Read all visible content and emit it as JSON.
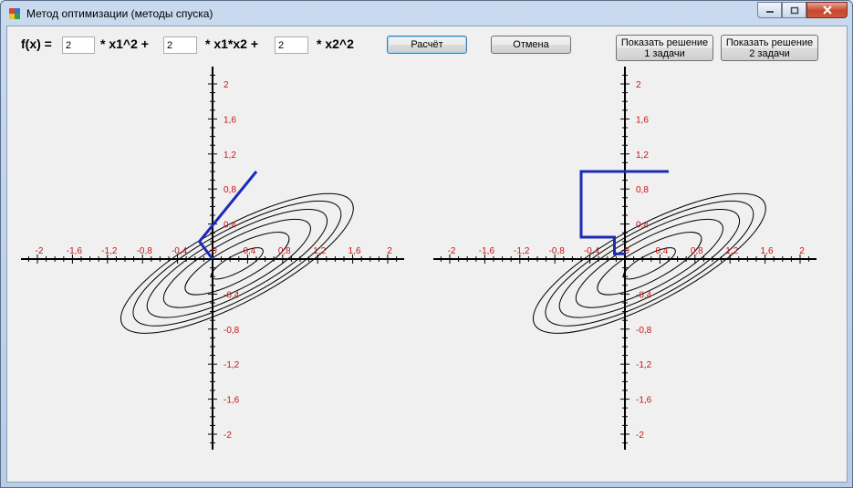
{
  "window": {
    "title": "Метод оптимизации (методы спуска)"
  },
  "form": {
    "fx_label": "f(x)  =",
    "coef1": "2",
    "term1_label": "* x1^2 +",
    "coef2": "2",
    "term2_label": "* x1*x2 +",
    "coef3": "2",
    "term3_label": "*  x2^2"
  },
  "buttons": {
    "calculate": "Расчёт",
    "cancel": "Отмена",
    "show1_line1": "Показать решение",
    "show1_line2": "1 задачи",
    "show2_line1": "Показать решение",
    "show2_line2": "2 задачи"
  },
  "chart_data": [
    {
      "type": "contour",
      "xlim": [
        -2,
        2
      ],
      "ylim": [
        -2,
        2
      ],
      "x_tick_labels": [
        "-2",
        "-1,6",
        "-1,2",
        "-0,8",
        "-0,4",
        "0",
        "0,4",
        "0,8",
        "1,2",
        "1,6",
        "2"
      ],
      "y_tick_labels": [
        "2",
        "1,6",
        "1,2",
        "0,8",
        "0,4",
        "-0,4",
        "-0,8",
        "-1,2",
        "-1,6",
        "-2"
      ],
      "contour_levels": [
        0.1,
        0.4,
        0.8,
        1.2,
        1.6,
        2.0
      ],
      "path": [
        [
          0.5,
          1.0
        ],
        [
          -0.15,
          0.2
        ],
        [
          0,
          0
        ]
      ],
      "path_color": "#1b2bb5",
      "tick_label_color": "#cc1111"
    },
    {
      "type": "contour",
      "xlim": [
        -2,
        2
      ],
      "ylim": [
        -2,
        2
      ],
      "x_tick_labels": [
        "-2",
        "-1,6",
        "-1,2",
        "-0,8",
        "-0,4",
        "0",
        "0,4",
        "0,8",
        "1,2",
        "1,6",
        "2"
      ],
      "y_tick_labels": [
        "2",
        "1,6",
        "1,2",
        "0,8",
        "0,4",
        "-0,4",
        "-0,8",
        "-1,2",
        "-1,6",
        "-2"
      ],
      "contour_levels": [
        0.1,
        0.4,
        0.8,
        1.2,
        1.6,
        2.0
      ],
      "path": [
        [
          0.5,
          1.0
        ],
        [
          -0.5,
          1.0
        ],
        [
          -0.5,
          0.25
        ],
        [
          -0.12,
          0.25
        ],
        [
          -0.12,
          0.06
        ],
        [
          0,
          0.06
        ]
      ],
      "path_color": "#1b2bb5",
      "tick_label_color": "#cc1111"
    }
  ]
}
